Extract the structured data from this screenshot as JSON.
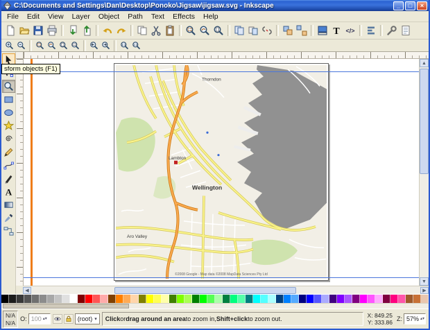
{
  "window": {
    "title": "C:\\Documents and Settings\\Dan\\Desktop\\Ponoko\\Jigsaw\\jigsaw.svg - Inkscape"
  },
  "menubar": {
    "items": [
      "File",
      "Edit",
      "View",
      "Layer",
      "Object",
      "Path",
      "Text",
      "Effects",
      "Help"
    ]
  },
  "command_bar": {
    "icons": [
      "new-document",
      "open-document",
      "save-document",
      "print",
      "|",
      "import",
      "export",
      "|",
      "undo",
      "redo",
      "|",
      "copy",
      "cut",
      "paste",
      "|",
      "zoom-selection",
      "zoom-drawing",
      "zoom-page",
      "|",
      "duplicate",
      "create-clone",
      "unlink-clone",
      "|",
      "group",
      "ungroup",
      "|",
      "fill-stroke-dialog",
      "text-dialog",
      "xml-editor",
      "|",
      "align-distribute-dialog",
      "|",
      "preferences",
      "document-properties"
    ]
  },
  "zoom_bar": {
    "icons": [
      "zoom-in",
      "zoom-out",
      "|",
      "zoom-selection",
      "zoom-drawing",
      "zoom-page",
      "zoom-page-width",
      "|",
      "zoom-previous",
      "zoom-next",
      "|",
      "zoom-1-1",
      "zoom-1-2"
    ]
  },
  "toolbox": {
    "tools": [
      "select-tool",
      "node-tool",
      "zoom-tool",
      "rectangle-tool",
      "ellipse-tool",
      "star-tool",
      "spiral-tool",
      "pencil-tool",
      "pen-tool",
      "calligraphy-tool",
      "text-tool",
      "gradient-tool",
      "dropper-tool",
      "connector-tool"
    ],
    "active_tool": "zoom-tool",
    "hovered_tool": "select-tool"
  },
  "tooltip": {
    "text": "sform objects (F1)"
  },
  "map": {
    "labels": {
      "thorndon": "Thorndon",
      "lambton": "Lambton",
      "wellington": "Wellington",
      "aro_valley": "Aro Valley"
    },
    "copyright": "©2008 Google - Map data ©2008 MapData Sciences Pty Ltd"
  },
  "palette": {
    "colors": [
      "#000000",
      "#1c1c1c",
      "#383838",
      "#545454",
      "#707070",
      "#8c8c8c",
      "#a8a8a8",
      "#c4c4c4",
      "#e0e0e0",
      "#ffffff",
      "#800000",
      "#ff0000",
      "#ff5555",
      "#ffaaaa",
      "#804000",
      "#ff8000",
      "#ffaa55",
      "#ffd5aa",
      "#808000",
      "#ffff00",
      "#ffff55",
      "#ffffaa",
      "#408000",
      "#80ff00",
      "#aaff55",
      "#008000",
      "#00ff00",
      "#55ff55",
      "#aaffaa",
      "#008040",
      "#00ff80",
      "#55ffaa",
      "#008080",
      "#00ffff",
      "#55ffff",
      "#aaffff",
      "#004080",
      "#0080ff",
      "#55aaff",
      "#000080",
      "#0000ff",
      "#5555ff",
      "#aaaaff",
      "#400080",
      "#8000ff",
      "#aa55ff",
      "#800080",
      "#ff00ff",
      "#ff55ff",
      "#ffaaff",
      "#800040",
      "#ff0080",
      "#ff55aa",
      "#a05a2c",
      "#c87137",
      "#e9c6af"
    ]
  },
  "statusbar": {
    "fill_value": "N/A",
    "stroke_value": "N/A",
    "opacity_label": "O:",
    "opacity_value": "100",
    "layer_name": "(root)",
    "message_parts": [
      {
        "text": "Click",
        "bold": true
      },
      {
        "text": " or ",
        "bold": false
      },
      {
        "text": "drag around an area",
        "bold": true
      },
      {
        "text": " to zoom in, ",
        "bold": false
      },
      {
        "text": "Shift+click",
        "bold": true
      },
      {
        "text": " to zoom out.",
        "bold": false
      }
    ],
    "x_label": "X:",
    "x_value": "849.25",
    "y_label": "Y:",
    "y_value": "333.86",
    "zoom_label": "Z:",
    "zoom_value": "57%"
  }
}
